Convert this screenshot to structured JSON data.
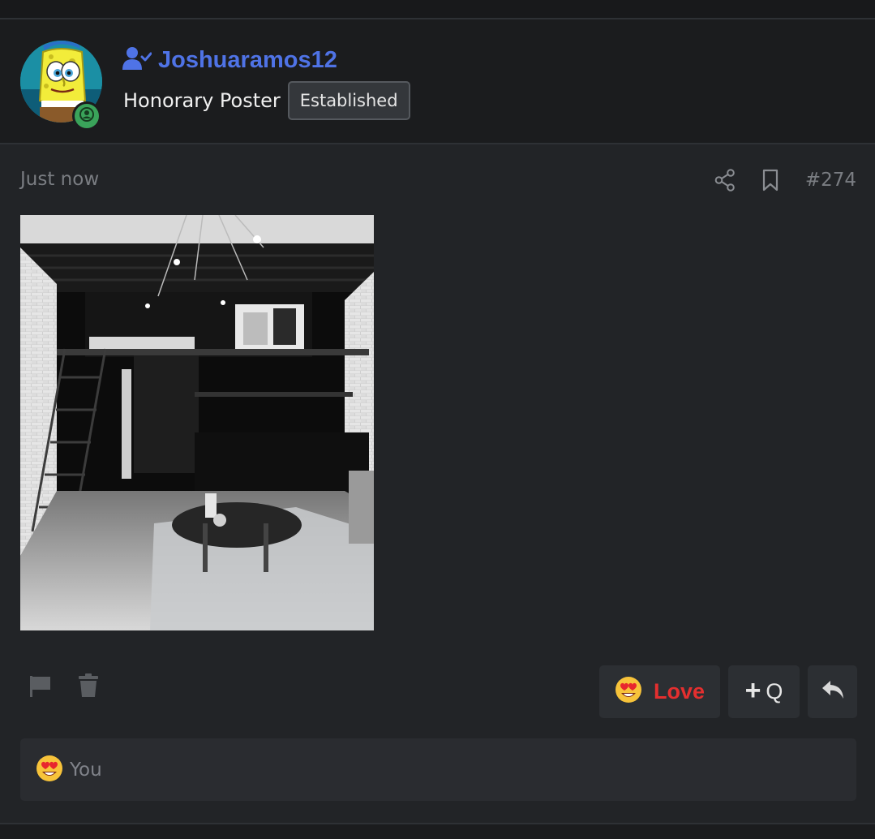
{
  "user": {
    "name": "Joshuaramos12",
    "title": "Honorary Poster",
    "rank": "Established",
    "avatar_icon": "spongebob-avatar",
    "verified_icon": "user-check-icon",
    "online_icon": "online-user-icon"
  },
  "post": {
    "timestamp": "Just now",
    "number": "#274",
    "share_icon": "share-icon",
    "bookmark_icon": "bookmark-icon",
    "attachment_icon": "loft-apartment-photo"
  },
  "actions": {
    "report_icon": "flag-icon",
    "delete_icon": "trash-icon",
    "love_label": "Love",
    "love_icon": "heart-eyes-emoji",
    "quote_plus": "+",
    "quote_label": "Q",
    "reply_icon": "reply-icon"
  },
  "reactions": {
    "summary": "You",
    "icon": "heart-eyes-emoji"
  },
  "colors": {
    "username": "#4f73e6",
    "love": "#e42f2f",
    "online": "#3aa35a",
    "background": "#222427"
  }
}
